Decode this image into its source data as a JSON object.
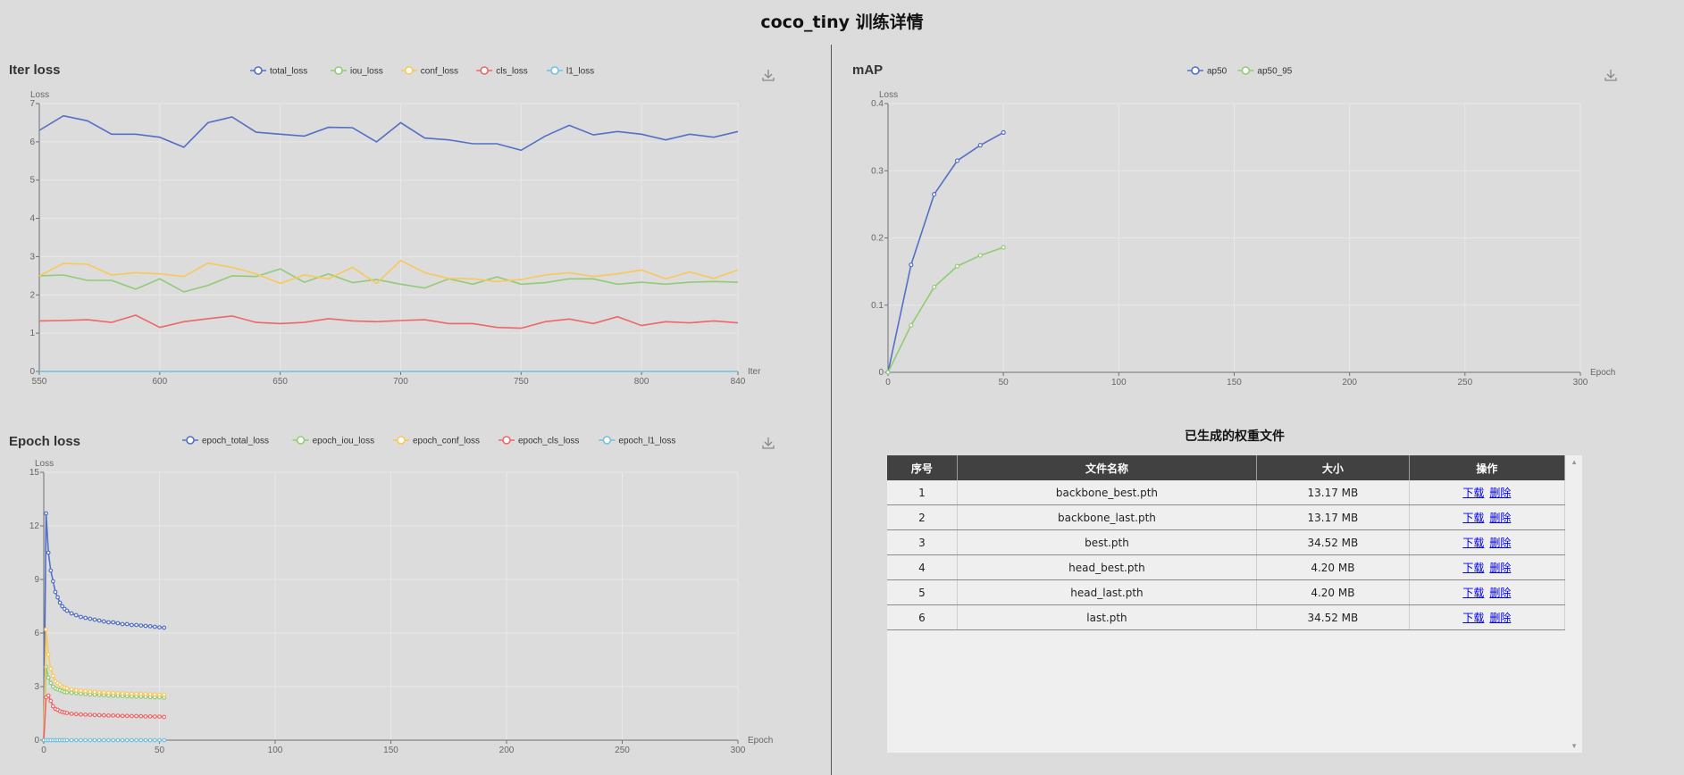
{
  "page": {
    "title": "coco_tiny 训练详情"
  },
  "colors": {
    "blue": "#5470c6",
    "green": "#91cc75",
    "yellow": "#fac858",
    "red": "#ee6666",
    "cyan": "#73c0de"
  },
  "icons": {
    "download": "download-icon",
    "scroll_up": "scroll-up-icon",
    "scroll_down": "scroll-down-icon"
  },
  "iter_loss": {
    "title": "Iter loss",
    "download_icon": "download-icon",
    "chart_data": {
      "type": "line",
      "title": "Iter loss",
      "xlabel": "Iter",
      "ylabel": "Loss",
      "xlim": [
        550,
        840
      ],
      "ylim": [
        0,
        7
      ],
      "x_ticks": [
        550,
        600,
        650,
        700,
        750,
        800,
        840
      ],
      "y_ticks": [
        0,
        1,
        2,
        3,
        4,
        5,
        6,
        7
      ],
      "grid": true,
      "legend_position": "top-center",
      "x": [
        550,
        560,
        570,
        580,
        590,
        600,
        610,
        620,
        630,
        640,
        650,
        660,
        670,
        680,
        690,
        700,
        710,
        720,
        730,
        740,
        750,
        760,
        770,
        780,
        790,
        800,
        810,
        820,
        830,
        840
      ],
      "series": [
        {
          "name": "total_loss",
          "color": "#5470c6",
          "values": [
            6.3,
            6.68,
            6.55,
            6.2,
            6.2,
            6.12,
            5.86,
            6.5,
            6.65,
            6.25,
            6.2,
            6.15,
            6.38,
            6.37,
            6.0,
            6.5,
            6.1,
            6.05,
            5.95,
            5.95,
            5.78,
            6.15,
            6.43,
            6.18,
            6.27,
            6.2,
            6.05,
            6.2,
            6.12,
            6.27
          ]
        },
        {
          "name": "iou_loss",
          "color": "#91cc75",
          "values": [
            2.5,
            2.52,
            2.38,
            2.38,
            2.15,
            2.42,
            2.08,
            2.25,
            2.5,
            2.48,
            2.68,
            2.33,
            2.55,
            2.32,
            2.4,
            2.28,
            2.18,
            2.42,
            2.28,
            2.47,
            2.28,
            2.32,
            2.42,
            2.42,
            2.28,
            2.33,
            2.28,
            2.33,
            2.35,
            2.33
          ]
        },
        {
          "name": "conf_loss",
          "color": "#fac858",
          "values": [
            2.5,
            2.82,
            2.8,
            2.52,
            2.58,
            2.55,
            2.48,
            2.83,
            2.72,
            2.55,
            2.3,
            2.52,
            2.42,
            2.72,
            2.3,
            2.9,
            2.58,
            2.43,
            2.42,
            2.35,
            2.4,
            2.52,
            2.58,
            2.48,
            2.55,
            2.65,
            2.42,
            2.6,
            2.43,
            2.65
          ]
        },
        {
          "name": "cls_loss",
          "color": "#ee6666",
          "values": [
            1.32,
            1.33,
            1.35,
            1.28,
            1.47,
            1.15,
            1.3,
            1.38,
            1.45,
            1.28,
            1.25,
            1.28,
            1.38,
            1.32,
            1.3,
            1.33,
            1.35,
            1.25,
            1.25,
            1.15,
            1.13,
            1.3,
            1.37,
            1.25,
            1.43,
            1.2,
            1.3,
            1.27,
            1.32,
            1.27
          ]
        },
        {
          "name": "l1_loss",
          "color": "#73c0de",
          "values": [
            0,
            0,
            0,
            0,
            0,
            0,
            0,
            0,
            0,
            0,
            0,
            0,
            0,
            0,
            0,
            0,
            0,
            0,
            0,
            0,
            0,
            0,
            0,
            0,
            0,
            0,
            0,
            0,
            0,
            0
          ]
        }
      ]
    }
  },
  "epoch_loss": {
    "title": "Epoch loss",
    "download_icon": "download-icon",
    "chart_data": {
      "type": "line",
      "title": "Epoch loss",
      "xlabel": "Epoch",
      "ylabel": "Loss",
      "xlim": [
        0,
        300
      ],
      "ylim": [
        0,
        15
      ],
      "x_ticks": [
        0,
        50,
        100,
        150,
        200,
        250,
        300
      ],
      "y_ticks": [
        0,
        3,
        6,
        9,
        12,
        15
      ],
      "grid": true,
      "legend_position": "top-center",
      "x": [
        0,
        1,
        2,
        3,
        4,
        5,
        6,
        7,
        8,
        9,
        10,
        12,
        14,
        16,
        18,
        20,
        22,
        24,
        26,
        28,
        30,
        32,
        34,
        36,
        38,
        40,
        42,
        44,
        46,
        48,
        50,
        52
      ],
      "series": [
        {
          "name": "epoch_total_loss",
          "color": "#5470c6",
          "values": [
            0,
            12.7,
            10.5,
            9.5,
            8.9,
            8.3,
            8.0,
            7.7,
            7.5,
            7.35,
            7.25,
            7.1,
            7.0,
            6.9,
            6.85,
            6.8,
            6.75,
            6.7,
            6.65,
            6.6,
            6.6,
            6.55,
            6.5,
            6.5,
            6.45,
            6.45,
            6.42,
            6.4,
            6.38,
            6.35,
            6.32,
            6.3
          ]
        },
        {
          "name": "epoch_iou_loss",
          "color": "#91cc75",
          "values": [
            0,
            4.1,
            3.5,
            3.2,
            3.0,
            2.9,
            2.85,
            2.8,
            2.75,
            2.7,
            2.68,
            2.65,
            2.62,
            2.6,
            2.58,
            2.56,
            2.55,
            2.53,
            2.52,
            2.5,
            2.49,
            2.48,
            2.47,
            2.46,
            2.45,
            2.44,
            2.43,
            2.42,
            2.41,
            2.4,
            2.4,
            2.38
          ]
        },
        {
          "name": "epoch_conf_loss",
          "color": "#fac858",
          "values": [
            0,
            6.2,
            4.8,
            4.0,
            3.6,
            3.3,
            3.2,
            3.1,
            3.0,
            2.95,
            2.9,
            2.85,
            2.8,
            2.77,
            2.75,
            2.72,
            2.7,
            2.68,
            2.67,
            2.65,
            2.64,
            2.63,
            2.62,
            2.61,
            2.6,
            2.6,
            2.59,
            2.58,
            2.57,
            2.56,
            2.55,
            2.55
          ]
        },
        {
          "name": "epoch_cls_loss",
          "color": "#ee6666",
          "values": [
            0,
            2.4,
            2.5,
            2.2,
            1.9,
            1.75,
            1.7,
            1.62,
            1.58,
            1.55,
            1.52,
            1.48,
            1.46,
            1.44,
            1.43,
            1.42,
            1.41,
            1.4,
            1.39,
            1.38,
            1.38,
            1.37,
            1.36,
            1.36,
            1.35,
            1.35,
            1.34,
            1.33,
            1.33,
            1.32,
            1.32,
            1.3
          ]
        },
        {
          "name": "epoch_l1_loss",
          "color": "#73c0de",
          "values": [
            0,
            0,
            0,
            0,
            0,
            0,
            0,
            0,
            0,
            0,
            0,
            0,
            0,
            0,
            0,
            0,
            0,
            0,
            0,
            0,
            0,
            0,
            0,
            0,
            0,
            0,
            0,
            0,
            0,
            0,
            0,
            0
          ]
        }
      ]
    }
  },
  "map": {
    "title": "mAP",
    "download_icon": "download-icon",
    "chart_data": {
      "type": "line",
      "title": "mAP",
      "xlabel": "Epoch",
      "ylabel": "Loss",
      "xlim": [
        0,
        300
      ],
      "ylim": [
        0,
        0.4
      ],
      "x_ticks": [
        0,
        50,
        100,
        150,
        200,
        250,
        300
      ],
      "y_ticks": [
        0,
        0.1,
        0.2,
        0.3,
        0.4
      ],
      "grid": true,
      "legend_position": "top-center",
      "x": [
        0,
        10,
        20,
        30,
        40,
        50
      ],
      "series": [
        {
          "name": "ap50",
          "color": "#5470c6",
          "values": [
            0.0,
            0.16,
            0.265,
            0.315,
            0.338,
            0.357
          ]
        },
        {
          "name": "ap50_95",
          "color": "#91cc75",
          "values": [
            0.0,
            0.07,
            0.127,
            0.158,
            0.174,
            0.186
          ]
        }
      ]
    }
  },
  "files": {
    "title": "已生成的权重文件",
    "headers": [
      "序号",
      "文件名称",
      "大小",
      "操作"
    ],
    "download_label": "下载",
    "delete_label": "删除",
    "rows": [
      {
        "index": "1",
        "name": "backbone_best.pth",
        "size": "13.17 MB"
      },
      {
        "index": "2",
        "name": "backbone_last.pth",
        "size": "13.17 MB"
      },
      {
        "index": "3",
        "name": "best.pth",
        "size": "34.52 MB"
      },
      {
        "index": "4",
        "name": "head_best.pth",
        "size": "4.20 MB"
      },
      {
        "index": "5",
        "name": "head_last.pth",
        "size": "4.20 MB"
      },
      {
        "index": "6",
        "name": "last.pth",
        "size": "34.52 MB"
      }
    ]
  }
}
